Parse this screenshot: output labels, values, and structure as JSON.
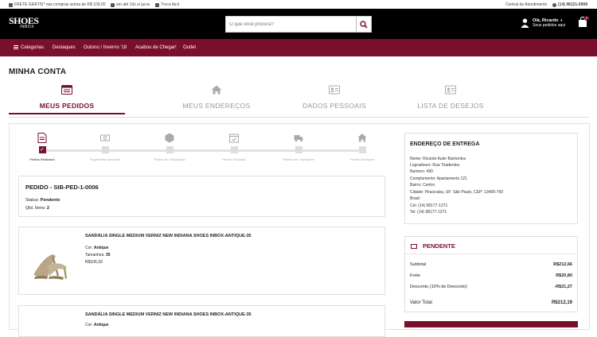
{
  "topbar": {
    "shipping": "FRETE GRÁTIS* nas compras acima de R$ 109,00",
    "installments": "em até 10x s/ juros",
    "exchange": "Troca fácil",
    "service": "Central de Atendimento",
    "whatsapp": "(14) 98121-6908"
  },
  "header": {
    "logo_top": "SHOES",
    "logo_bottom": "INBOX",
    "search_placeholder": "O que você procura?",
    "greeting": "Olá, Ricardo",
    "orders_link": "Seus pedidos aqui",
    "cart_count": "0"
  },
  "nav": {
    "categories": "Categorias",
    "items": [
      "Destaques",
      "Outono / Inverno '18",
      "Acabou de Chegar!",
      "Outlet"
    ]
  },
  "page": {
    "title": "MINHA CONTA"
  },
  "tabs": [
    {
      "label": "MEUS PEDIDOS",
      "icon": "list-icon"
    },
    {
      "label": "MEUS ENDEREÇOS",
      "icon": "home-icon"
    },
    {
      "label": "DADOS PESSOAIS",
      "icon": "id-card-icon"
    },
    {
      "label": "LISTA DE DESEJOS",
      "icon": "id-card-icon"
    }
  ],
  "steps": [
    {
      "label": "Pedido Realizado",
      "icon": "document-icon",
      "done": true
    },
    {
      "label": "Pagamento Aprovado",
      "icon": "money-icon",
      "done": false
    },
    {
      "label": "Pedido em Separação",
      "icon": "box-icon",
      "done": false
    },
    {
      "label": "Pedido Faturado",
      "icon": "calendar-icon",
      "done": false
    },
    {
      "label": "Pedido em Transporte",
      "icon": "truck-icon",
      "done": false
    },
    {
      "label": "Pedido Entregue",
      "icon": "home-icon",
      "done": false
    }
  ],
  "order": {
    "title": "PEDIDO - SIB-PED-1-0006",
    "status_label": "Status:",
    "status_value": "Pendente",
    "items_label": "Qtd. Itens:",
    "items_value": "2"
  },
  "products": [
    {
      "name": "SANDÁLIA SINGLE MEDIUM VERNIZ NEW INDIANA SHOES INBOX-ANTIQUE-35",
      "color_label": "Cor:",
      "color": "Antique",
      "size_label": "Tamanhos:",
      "size": "35",
      "price": "R$106,33"
    },
    {
      "name": "SANDÁLIA SINGLE MEDIUM VERNIZ NEW INDIANA SHOES INBOX-ANTIQUE-35",
      "color_label": "Cor:",
      "color": "Antique"
    }
  ],
  "address": {
    "title": "ENDEREÇO DE ENTREGA",
    "lines": [
      "Nome: Ricardo Auler Barrientos",
      "Logradouro: Rua Tiradentes",
      "Numero: 490",
      "Complemento: Apartamento 121",
      "Bairro: Centro",
      "Cidade: Piracicaba, UF: São Paulo, CEP: 13400-760",
      "Brasil",
      "Cel: (14) 98177-1371",
      "Tel: (14) 98177-1371"
    ]
  },
  "summary": {
    "status": "PENDENTE",
    "rows": [
      {
        "label": "Subtotal",
        "value": "R$212,66"
      },
      {
        "label": "Frete",
        "value": "R$20,80"
      },
      {
        "label": "Desconto (10% de Desconto)",
        "value": "-R$21,27"
      }
    ],
    "total_label": "Valor Total",
    "total_value": "R$212,19"
  },
  "colors": {
    "brand": "#7a0f2c",
    "header_bg": "#000000"
  }
}
